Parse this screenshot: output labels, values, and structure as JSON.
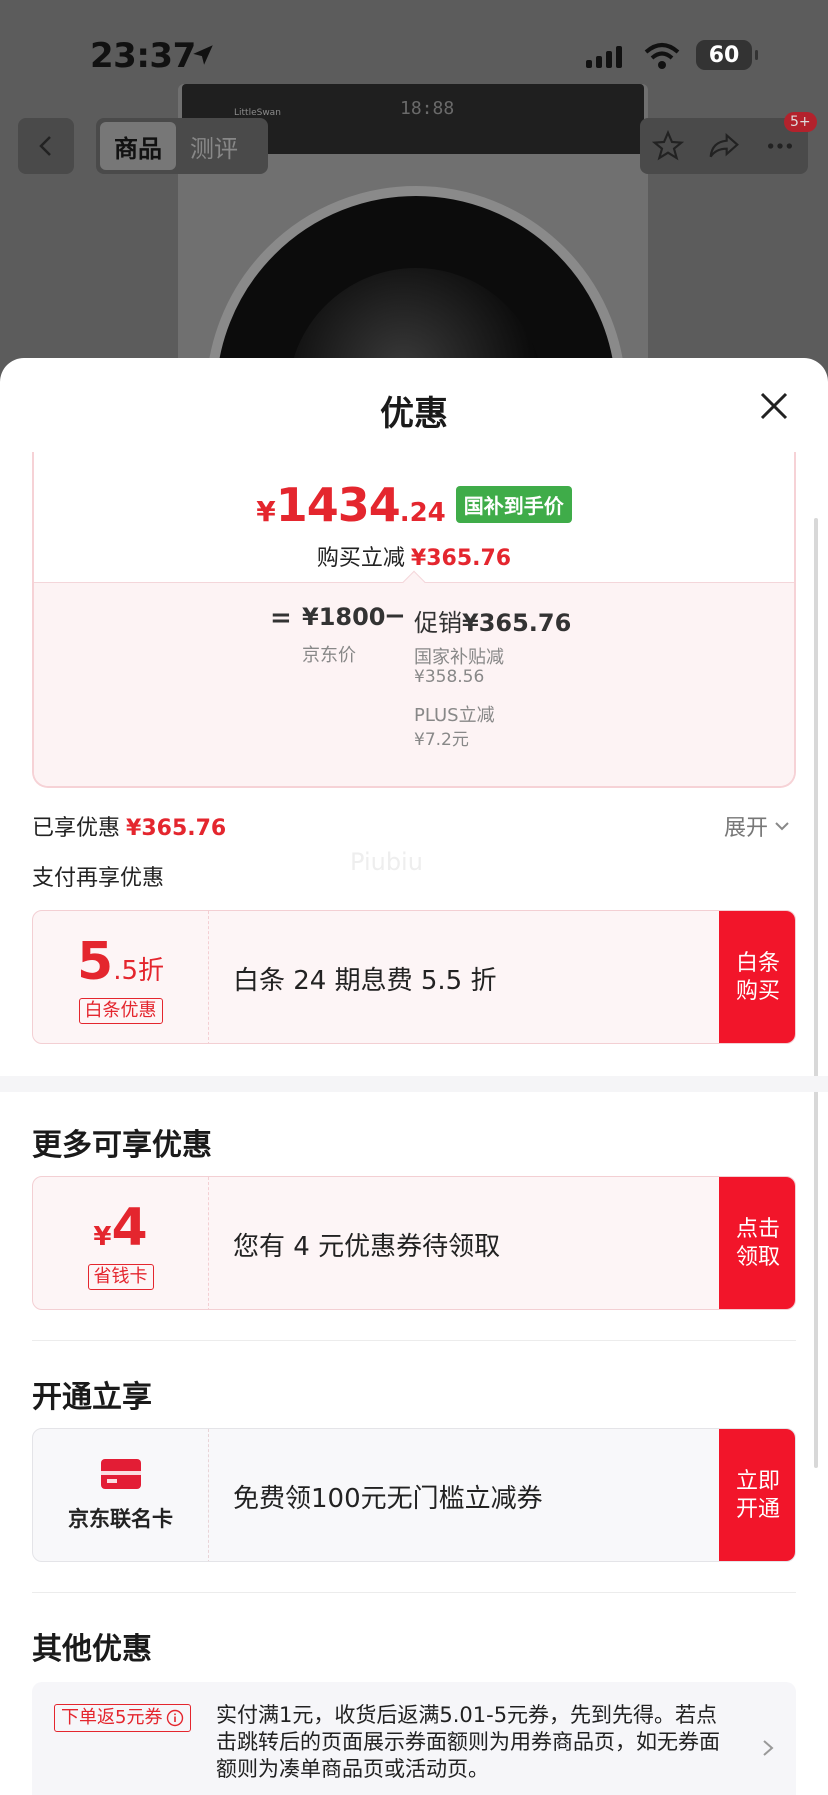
{
  "status_bar": {
    "time": "23:37",
    "battery": "60"
  },
  "nav": {
    "tabs": [
      {
        "label": "商品",
        "active": true
      },
      {
        "label": "测评",
        "active": false
      }
    ],
    "badge": "5+",
    "icons": [
      "back-icon",
      "star-icon",
      "share-icon",
      "more-icon"
    ]
  },
  "background_product": {
    "panel_digits": "18:88",
    "brand": "LittleSwan"
  },
  "sheet": {
    "title": "优惠",
    "price_card": {
      "symbol": "¥",
      "price_int": "1434",
      "price_dec": ".24",
      "tag": "国补到手价",
      "reduce_label": "购买立减",
      "reduce_value": "¥365.76",
      "breakdown": {
        "eq": "=",
        "jd_price": "¥1800",
        "jd_label": "京东价",
        "minus": "−",
        "promo_label": "促销",
        "promo_value": "¥365.76",
        "sub_items": [
          {
            "label": "国家补贴减",
            "value": "¥358.56"
          },
          {
            "label": "PLUS立减",
            "value": "¥7.2元"
          }
        ]
      }
    },
    "enjoyed_label": "已享优惠",
    "enjoyed_value": "¥365.76",
    "expand_label": "展开",
    "watermark": "Piubiu",
    "pay_more_label": "支付再享优惠",
    "baitiao_coupon": {
      "big": "5",
      "small": ".5折",
      "tag": "白条优惠",
      "text": "白条 24 期息费 5.5 折",
      "button": "白条购买"
    },
    "more_section": {
      "title": "更多可享优惠",
      "coupon": {
        "symbol": "¥",
        "big": "4",
        "tag": "省钱卡",
        "text": "您有 4 元优惠券待领取",
        "button": "点击领取"
      }
    },
    "open_section": {
      "title": "开通立享",
      "coupon": {
        "label": "京东联名卡",
        "text": "免费领100元无门槛立减券",
        "button": "立即开通"
      }
    },
    "other_section": {
      "title": "其他优惠",
      "tag": "下单返5元券",
      "text": "实付满1元，收货后返满5.01-5元券，先到先得。若点击跳转后的页面展示券面额则为用券商品页，如无券面额则为凑单商品页或活动页。"
    }
  },
  "colors": {
    "accent_red": "#e4262e",
    "button_red": "#f2152a",
    "green_tag": "#3fac49"
  }
}
